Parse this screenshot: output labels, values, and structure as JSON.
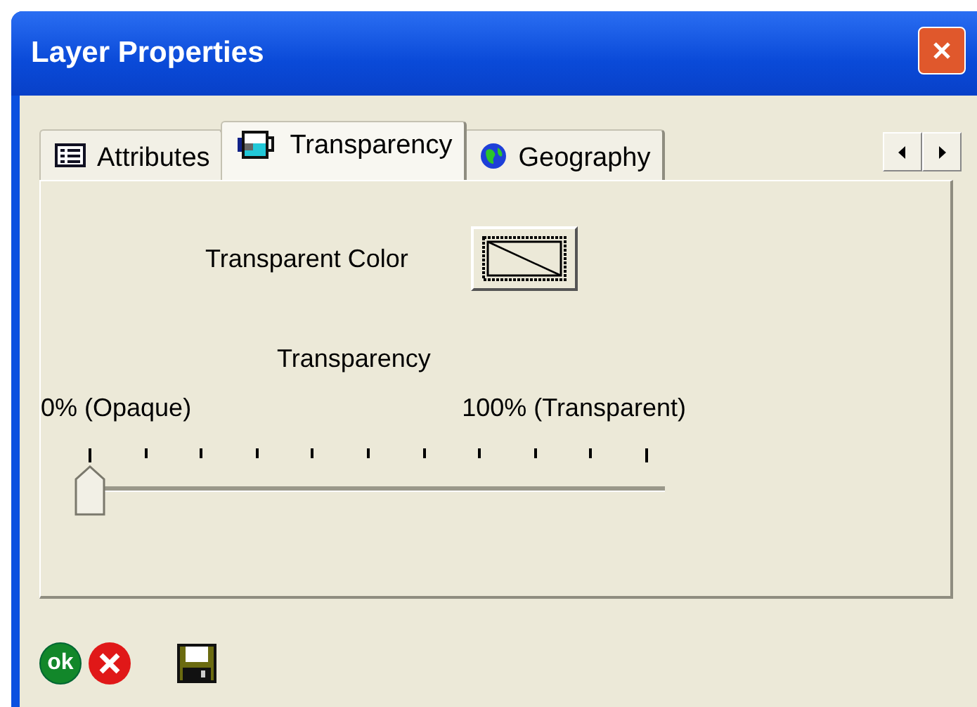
{
  "window": {
    "title": "Layer Properties"
  },
  "tabs": [
    {
      "label": "Attributes",
      "kind": "table",
      "selected": false
    },
    {
      "label": "Transparency",
      "kind": "cup",
      "selected": true
    },
    {
      "label": "Geography",
      "kind": "globe",
      "selected": false
    }
  ],
  "transparent_color": {
    "label": "Transparent Color"
  },
  "transparency": {
    "label": "Transparency",
    "min_label": "0% (Opaque)",
    "max_label": "100% (Transparent)",
    "level": 0
  },
  "footer": {
    "ok_label": "ok"
  }
}
